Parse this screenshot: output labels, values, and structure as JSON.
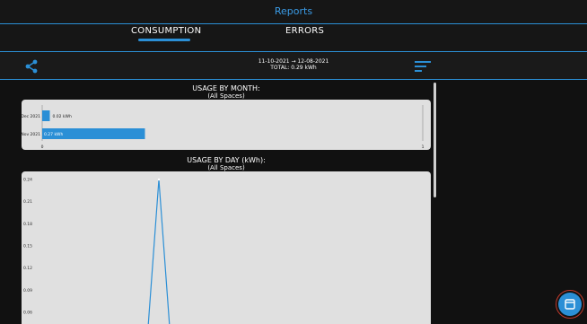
{
  "app": {
    "title": "Reports"
  },
  "tabs": [
    {
      "label": "CONSUMPTION",
      "active": true
    },
    {
      "label": "ERRORS",
      "active": false
    }
  ],
  "toolbar": {
    "date_range": "11-10-2021 → 12-08-2021",
    "total": "TOTAL: 0.29 kWh",
    "share_icon": "share-icon",
    "filter_icon": "sort-icon"
  },
  "monthly": {
    "title": "USAGE BY MONTH:",
    "subtitle": "(All Spaces)"
  },
  "daily": {
    "title": "USAGE BY DAY (kWh):",
    "subtitle": "(All Spaces)"
  },
  "fab": {
    "icon": "calendar-icon"
  },
  "colors": {
    "accent": "#2b8fd6",
    "background": "#111111",
    "card": "#e0e0e0"
  },
  "chart_data": [
    {
      "type": "bar",
      "orientation": "horizontal",
      "categories": [
        "Dec 2021",
        "Nov 2021"
      ],
      "values": [
        0.02,
        0.27
      ],
      "data_labels": [
        "0.02 kWh",
        "0.27 kWh"
      ],
      "xticks": [
        "0",
        "1"
      ],
      "xlim": [
        0,
        1
      ]
    },
    {
      "type": "line",
      "yticks": [
        "0.24",
        "0.21",
        "0.18",
        "0.15",
        "0.12",
        "0.09",
        "0.06"
      ],
      "ylim_visible": [
        0.05,
        0.24
      ],
      "series": [
        {
          "points": [
            [
              0,
              0.04
            ],
            [
              1,
              0.24
            ],
            [
              2,
              0.04
            ]
          ]
        }
      ]
    }
  ]
}
